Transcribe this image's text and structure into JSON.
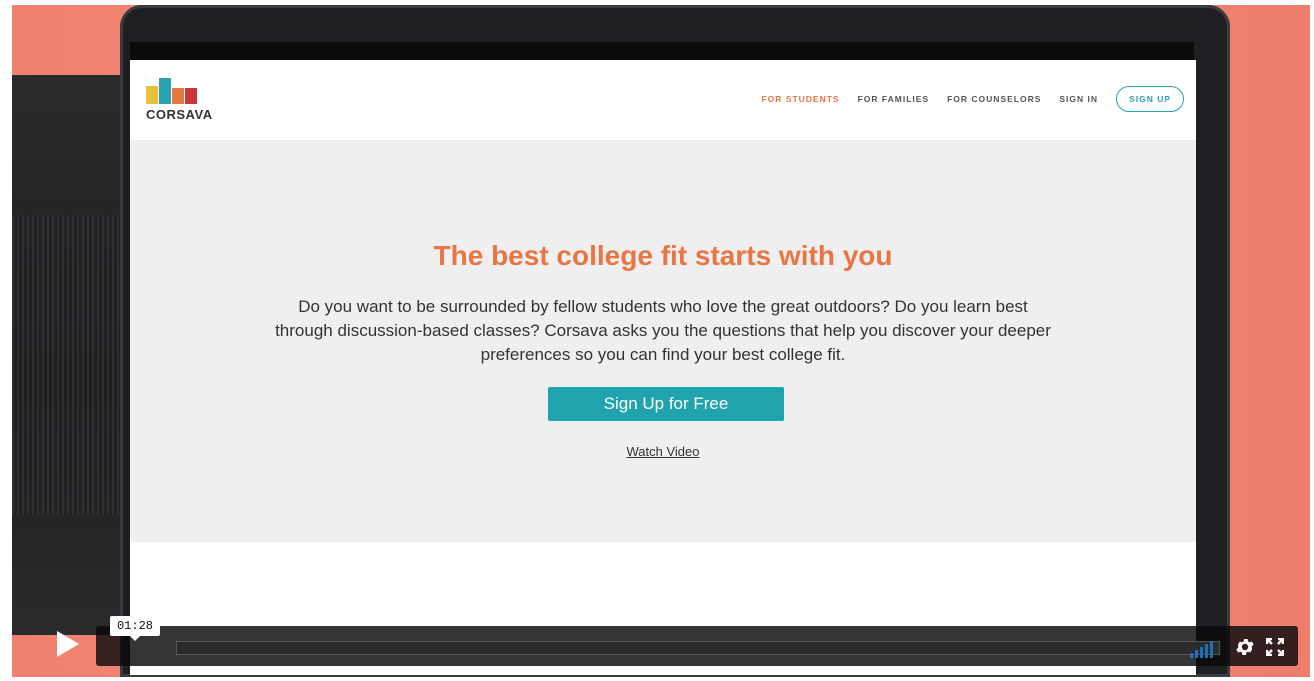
{
  "site": {
    "logo_text": "CORSAVA",
    "nav": [
      {
        "label": "FOR STUDENTS",
        "active": true
      },
      {
        "label": "FOR FAMILIES",
        "active": false
      },
      {
        "label": "FOR COUNSELORS",
        "active": false
      },
      {
        "label": "SIGN IN",
        "active": false
      }
    ],
    "signup_label": "SIGN UP"
  },
  "hero": {
    "title": "The best college fit starts with you",
    "body": "Do you want to be surrounded by fellow students who love the great outdoors? Do you learn best through discussion-based classes? Corsava asks you the questions that help you discover your deeper preferences so you can find your best college fit.",
    "cta_label": "Sign Up for Free",
    "watch_label": "Watch Video"
  },
  "player": {
    "time": "01:28",
    "progress": 0.0,
    "volume_level": 1.0
  },
  "colors": {
    "accent_orange": "#e87644",
    "accent_teal": "#1fa4ae",
    "background_coral": "#f48b78"
  },
  "icons": [
    "play-icon",
    "volume-icon",
    "gear-icon",
    "fullscreen-icon"
  ]
}
